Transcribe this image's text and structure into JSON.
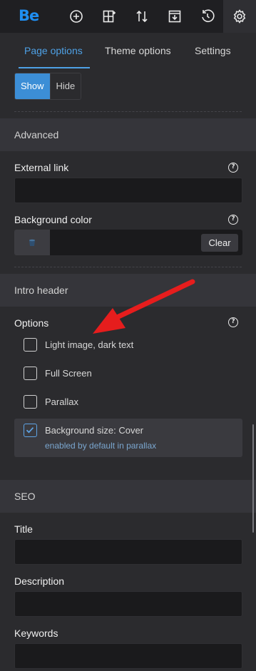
{
  "topbar": {
    "logo": "Be",
    "buttons": [
      {
        "icon": "add-circle-icon"
      },
      {
        "icon": "add-section-icon"
      },
      {
        "icon": "sort-icon"
      },
      {
        "icon": "save-download-icon"
      },
      {
        "icon": "history-icon"
      },
      {
        "icon": "gear-icon"
      }
    ]
  },
  "tabs": [
    "Page options",
    "Theme options",
    "Settings"
  ],
  "visibility": {
    "show": "Show",
    "hide": "Hide"
  },
  "advanced": {
    "title": "Advanced",
    "external_link": "External link",
    "background_color": "Background color",
    "clear": "Clear"
  },
  "intro": {
    "title": "Intro header",
    "options_label": "Options",
    "options": [
      {
        "label": "Light image, dark text",
        "checked": false
      },
      {
        "label": "Full Screen",
        "checked": false
      },
      {
        "label": "Parallax",
        "checked": false
      },
      {
        "label": "Background size: Cover",
        "checked": true,
        "note": "enabled by default in parallax"
      }
    ]
  },
  "seo": {
    "title": "SEO",
    "title_label": "Title",
    "description_label": "Description",
    "keywords_label": "Keywords"
  },
  "colors": {
    "accent": "#4ea1e6",
    "annotation": "#e61d1d"
  }
}
